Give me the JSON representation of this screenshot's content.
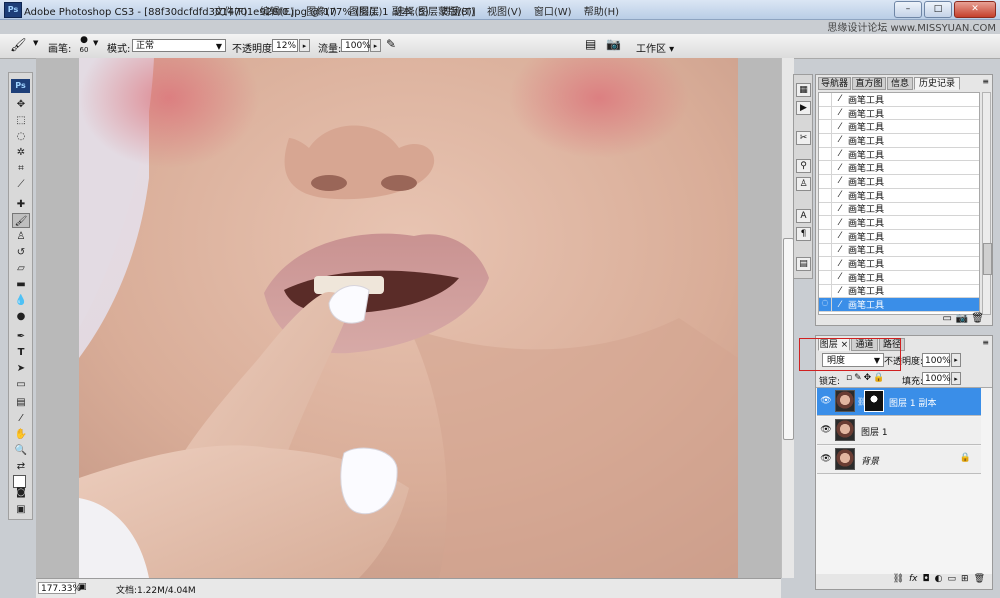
{
  "window": {
    "title": "Adobe Photoshop CS3 - [88f30dcfdfd3014701e928f0.jpg @ 177% (图层 1 副本, 图层蒙版/8)]",
    "watermark": "思缘设计论坛 www.MISSYUAN.COM"
  },
  "menu": [
    "文件(F)",
    "编辑(E)",
    "图像(I)",
    "图层(L)",
    "选择(S)",
    "滤镜(T)",
    "视图(V)",
    "窗口(W)",
    "帮助(H)"
  ],
  "options": {
    "brush_label": "画笔:",
    "brush_size": "60",
    "mode_label": "模式:",
    "mode_value": "正常",
    "opacity_label": "不透明度:",
    "opacity_value": "12%",
    "flow_label": "流量:",
    "flow_value": "100%",
    "workspace_label": "工作区"
  },
  "toolbox": {
    "badge": "Ps"
  },
  "status": {
    "zoom": "177.33%",
    "doc": "文档:1.22M/4.04M"
  },
  "history": {
    "tabs": [
      "导航器",
      "直方图",
      "信息",
      "历史记录"
    ],
    "items": [
      "画笔工具",
      "画笔工具",
      "画笔工具",
      "画笔工具",
      "画笔工具",
      "画笔工具",
      "画笔工具",
      "画笔工具",
      "画笔工具",
      "画笔工具",
      "画笔工具",
      "画笔工具",
      "画笔工具",
      "画笔工具",
      "画笔工具",
      "画笔工具"
    ],
    "selected_index": 15
  },
  "layers": {
    "tabs": [
      "图层",
      "通道",
      "路径"
    ],
    "blend_mode": "明度",
    "opacity_label": "不透明度:",
    "opacity_value": "100%",
    "lock_label": "锁定:",
    "fill_label": "填充:",
    "fill_value": "100%",
    "items": [
      {
        "name": "图层 1 副本",
        "selected": true,
        "has_mask": true
      },
      {
        "name": "图层 1",
        "selected": false,
        "has_mask": false
      },
      {
        "name": "背景",
        "selected": false,
        "has_mask": false,
        "locked": true
      }
    ]
  },
  "colors": {
    "selection": "#3a8ee8",
    "highlight_box": "#d02020"
  }
}
